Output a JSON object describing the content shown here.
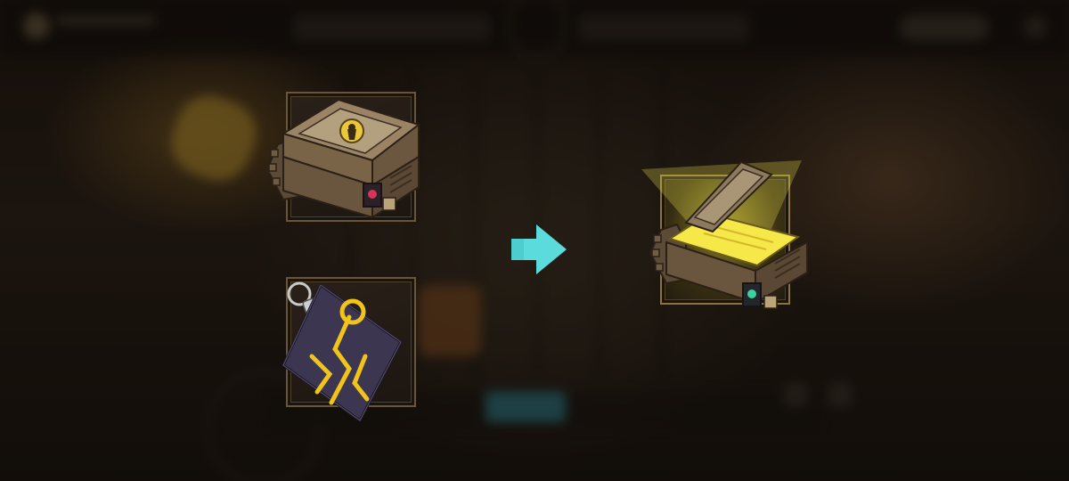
{
  "scene": {
    "description_visible_text": "",
    "accent_arrow_color": "#5fe6e6",
    "glow_color": "#f2e94a",
    "frame_border_color": "#6a5538"
  },
  "items": {
    "locked_chest": {
      "icon": "locked-chest-icon"
    },
    "key_card": {
      "icon": "key-card-icon"
    },
    "opened_chest": {
      "icon": "opened-chest-icon"
    },
    "arrow": {
      "icon": "arrow-right-icon"
    }
  }
}
